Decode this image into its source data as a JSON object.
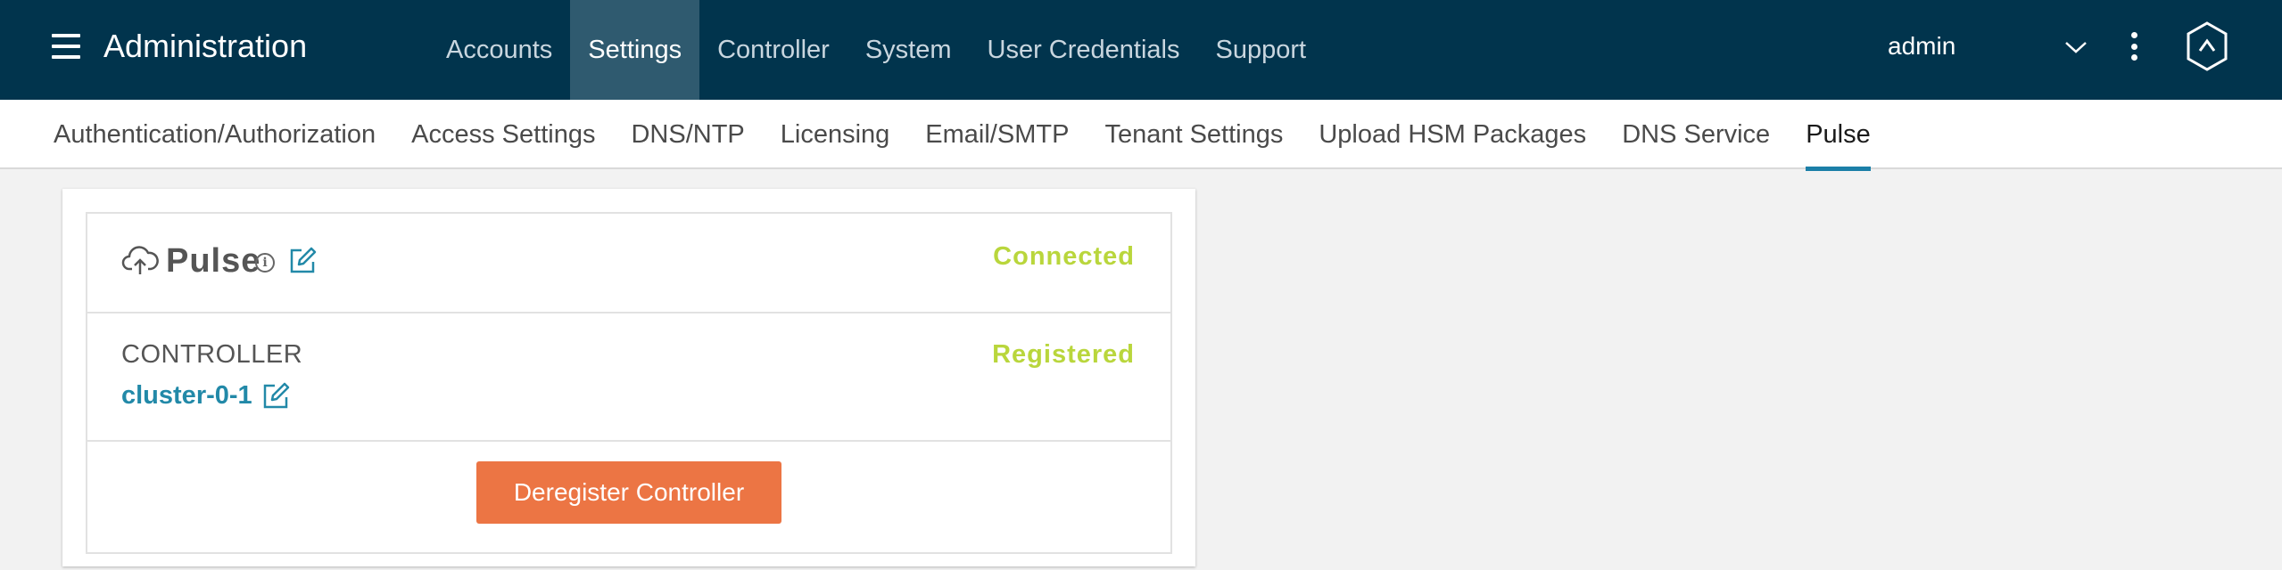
{
  "header": {
    "app_title": "Administration",
    "nav": [
      {
        "label": "Accounts",
        "active": false
      },
      {
        "label": "Settings",
        "active": true
      },
      {
        "label": "Controller",
        "active": false
      },
      {
        "label": "System",
        "active": false
      },
      {
        "label": "User Credentials",
        "active": false
      },
      {
        "label": "Support",
        "active": false
      }
    ],
    "user": "admin",
    "icons": [
      "hamburger-icon",
      "chevron-down-icon",
      "kebab-menu-icon",
      "brand-logo-icon"
    ]
  },
  "subnav": {
    "tabs": [
      {
        "label": "Authentication/Authorization",
        "active": false
      },
      {
        "label": "Access Settings",
        "active": false
      },
      {
        "label": "DNS/NTP",
        "active": false
      },
      {
        "label": "Licensing",
        "active": false
      },
      {
        "label": "Email/SMTP",
        "active": false
      },
      {
        "label": "Tenant Settings",
        "active": false
      },
      {
        "label": "Upload HSM Packages",
        "active": false
      },
      {
        "label": "DNS Service",
        "active": false
      },
      {
        "label": "Pulse",
        "active": true
      }
    ]
  },
  "pulse_card": {
    "title": "Pulse",
    "info_glyph": "i",
    "connection_status": "Connected",
    "controller_label": "CONTROLLER",
    "controller_name": "cluster-0-1",
    "registration_status": "Registered",
    "deregister_button": "Deregister Controller",
    "icons": [
      "cloud-upload-icon",
      "info-icon",
      "edit-icon"
    ]
  },
  "colors": {
    "header_bg": "#01344d",
    "active_nav_bg": "#2f5a6f",
    "status_green": "#b9d63c",
    "link_teal": "#2289a8",
    "tab_underline": "#1b7fa8",
    "button_orange": "#ec7544"
  }
}
